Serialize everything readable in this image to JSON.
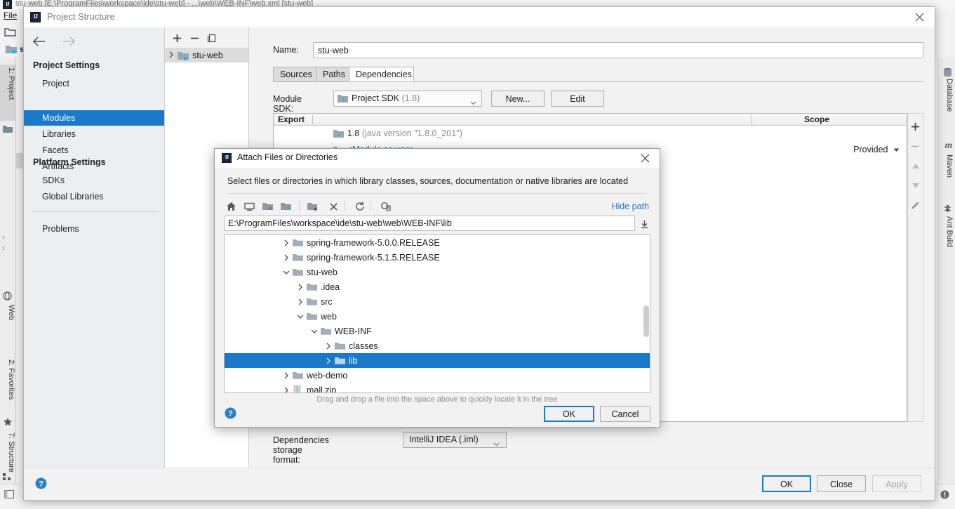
{
  "ide": {
    "title": "stu-web [E:\\ProgramFiles\\workspace\\ide\\stu-web] - ...\\web\\WEB-INF\\web.xml [stu-web]",
    "menu_file": "File",
    "breadcrumb": "stu-web",
    "left_tabs": [
      {
        "label": "1: Project",
        "icon": "project-icon",
        "selected": true
      },
      {
        "label": "Web",
        "icon": "web-icon",
        "selected": false
      },
      {
        "label": "2: Favorites",
        "icon": "star-icon",
        "selected": false
      },
      {
        "label": "7: Structure",
        "icon": "structure-icon",
        "selected": false
      }
    ],
    "right_tabs": [
      {
        "label": "Database",
        "icon": "database-icon"
      },
      {
        "label": "Maven",
        "icon": "maven-icon"
      },
      {
        "label": "Ant Build",
        "icon": "ant-icon"
      }
    ]
  },
  "project_structure": {
    "title": "Project Structure",
    "close_tooltip": "Close",
    "nav": {
      "back_icon": "arrow-left-icon",
      "forward_icon": "arrow-right-icon",
      "groups": [
        {
          "label": "Project Settings",
          "items": [
            {
              "label": "Project",
              "selected": false
            },
            {
              "label": "Modules",
              "selected": true
            },
            {
              "label": "Libraries",
              "selected": false
            },
            {
              "label": "Facets",
              "selected": false
            },
            {
              "label": "Artifacts",
              "selected": false
            }
          ]
        },
        {
          "label": "Platform Settings",
          "items": [
            {
              "label": "SDKs",
              "selected": false
            },
            {
              "label": "Global Libraries",
              "selected": false
            }
          ]
        }
      ],
      "extra_items": [
        {
          "label": "Problems",
          "selected": false
        }
      ]
    },
    "modules": {
      "toolbar": [
        {
          "icon": "plus-icon",
          "label": "Add"
        },
        {
          "icon": "minus-icon",
          "label": "Remove"
        },
        {
          "icon": "copy-icon",
          "label": "Copy"
        }
      ],
      "tree": [
        {
          "label": "stu-web",
          "icon": "module-folder-icon",
          "expanded": false,
          "selected": true
        }
      ]
    },
    "detail": {
      "name_label": "Name:",
      "name_value": "stu-web",
      "tabs": [
        {
          "label": "Sources",
          "selected": false
        },
        {
          "label": "Paths",
          "selected": false
        },
        {
          "label": "Dependencies",
          "selected": true
        }
      ],
      "sdk_label": "Module SDK:",
      "sdk_value": "Project SDK",
      "sdk_version": "(1.8)",
      "new_button": "New...",
      "edit_button": "Edit",
      "table": {
        "columns": [
          "Export",
          "Scope"
        ],
        "rows": [
          {
            "name": "1.8",
            "detail": "(java version \"1.8.0_201\")",
            "icon": "sdk-icon",
            "link": false,
            "scope": ""
          },
          {
            "name": "<Module source>",
            "detail": "",
            "icon": "module-source-icon",
            "link": true,
            "scope": "Provided"
          }
        ]
      },
      "side_buttons": [
        {
          "icon": "plus-icon",
          "label": "Add",
          "enabled": true
        },
        {
          "icon": "minus-icon",
          "label": "Remove",
          "enabled": false
        },
        {
          "icon": "arrow-up-icon",
          "label": "Move Up",
          "enabled": false
        },
        {
          "icon": "arrow-down-icon",
          "label": "Move Down",
          "enabled": false
        },
        {
          "icon": "pencil-icon",
          "label": "Edit",
          "enabled": false
        }
      ],
      "storage_label": "Dependencies storage format:",
      "storage_value": "IntelliJ IDEA (.iml)"
    },
    "footer": {
      "ok": "OK",
      "close": "Close",
      "apply": "Apply",
      "help_icon": "help-icon"
    }
  },
  "attach_dialog": {
    "title": "Attach Files or Directories",
    "description": "Select files or directories in which library classes, sources, documentation or native libraries are located",
    "toolbar": [
      {
        "icon": "home-icon",
        "label": "Home"
      },
      {
        "icon": "desktop-icon",
        "label": "Desktop"
      },
      {
        "icon": "project-folder-icon",
        "label": "Project"
      },
      {
        "icon": "module-folder-icon",
        "label": "Module"
      },
      {
        "icon": "new-folder-icon",
        "label": "New Folder"
      },
      {
        "icon": "delete-icon",
        "label": "Delete"
      },
      {
        "icon": "refresh-icon",
        "label": "Refresh"
      },
      {
        "icon": "show-hidden-icon",
        "label": "Show Hidden Files"
      }
    ],
    "hide_path_link": "Hide path",
    "path_value": "E:\\ProgramFiles\\workspace\\ide\\stu-web\\web\\WEB-INF\\lib",
    "path_dropdown_icon": "download-icon",
    "tree": [
      {
        "label": "spring-framework-5.0.0.RELEASE",
        "depth": 1,
        "icon": "folder-icon",
        "state": "collapsed",
        "selected": false
      },
      {
        "label": "spring-framework-5.1.5.RELEASE",
        "depth": 1,
        "icon": "folder-icon",
        "state": "collapsed",
        "selected": false
      },
      {
        "label": "stu-web",
        "depth": 1,
        "icon": "folder-icon",
        "state": "expanded",
        "selected": false
      },
      {
        "label": ".idea",
        "depth": 2,
        "icon": "folder-icon",
        "state": "collapsed",
        "selected": false
      },
      {
        "label": "src",
        "depth": 2,
        "icon": "folder-icon",
        "state": "collapsed",
        "selected": false
      },
      {
        "label": "web",
        "depth": 2,
        "icon": "folder-icon",
        "state": "expanded",
        "selected": false
      },
      {
        "label": "WEB-INF",
        "depth": 3,
        "icon": "folder-icon",
        "state": "expanded",
        "selected": false
      },
      {
        "label": "classes",
        "depth": 4,
        "icon": "folder-icon",
        "state": "collapsed",
        "selected": false
      },
      {
        "label": "lib",
        "depth": 4,
        "icon": "folder-icon",
        "state": "collapsed",
        "selected": true
      },
      {
        "label": "web-demo",
        "depth": 1,
        "icon": "folder-icon",
        "state": "collapsed",
        "selected": false
      },
      {
        "label": "mall.zip",
        "depth": 1,
        "icon": "archive-icon",
        "state": "collapsed",
        "selected": false
      }
    ],
    "hint": "Drag and drop a file into the space above to quickly locate it in the tree",
    "footer": {
      "ok": "OK",
      "cancel": "Cancel",
      "help_icon": "help-icon"
    }
  },
  "colors": {
    "selection_blue": "#1a7ac9",
    "link_blue": "#2f6fb5",
    "dialog_bg": "#f2f2f2",
    "nav_bg": "#eceff1",
    "table_bg": "#ffffff"
  }
}
